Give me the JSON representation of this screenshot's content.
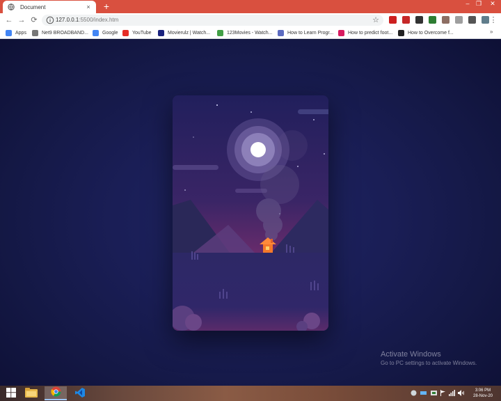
{
  "browser": {
    "tab_title": "Document",
    "tab_close": "×",
    "new_tab": "+",
    "window_controls": {
      "minimize": "–",
      "maximize": "❐",
      "close": "✕"
    },
    "nav": {
      "back": "←",
      "forward": "→",
      "reload": "⟳"
    },
    "url_host": "127.0.0.1",
    "url_path": ":5500/index.htm",
    "bookmark_star": "☆",
    "menu": "⋮",
    "extensions": [
      {
        "name": "opera-icon",
        "color": "#cc1f1f"
      },
      {
        "name": "red-box-icon",
        "color": "#c62828"
      },
      {
        "name": "store-icon",
        "color": "#333333"
      },
      {
        "name": "green-cube-icon",
        "color": "#2e7d32"
      },
      {
        "name": "grid-icon",
        "color": "#8d6e63"
      },
      {
        "name": "cloud-icon",
        "color": "#9e9e9e"
      },
      {
        "name": "puzzle-icon",
        "color": "#555555"
      },
      {
        "name": "profile-icon",
        "color": "#607d8b"
      }
    ]
  },
  "bookmarks": [
    {
      "label": "Apps",
      "icon": "apps-grid-icon",
      "color": "#4285f4"
    },
    {
      "label": "Net9 BROADBAND...",
      "icon": "globe-icon",
      "color": "#777777"
    },
    {
      "label": "Google",
      "icon": "google-icon",
      "color": "#4285f4"
    },
    {
      "label": "YouTube",
      "icon": "youtube-icon",
      "color": "#e52d27"
    },
    {
      "label": "Movierulz | Watch...",
      "icon": "movierulz-icon",
      "color": "#1a237e"
    },
    {
      "label": "123Movies - Watch...",
      "icon": "movies-icon",
      "color": "#43a047"
    },
    {
      "label": "How to Learn Progr...",
      "icon": "learn-icon",
      "color": "#5c6bc0"
    },
    {
      "label": "How to predict foot...",
      "icon": "k-icon",
      "color": "#d81b60"
    },
    {
      "label": "How to Overcome f...",
      "icon": "medium-icon",
      "color": "#222222"
    }
  ],
  "bookmarks_more": "»",
  "page": {
    "colors": {
      "sky_top": "#23215e",
      "sky_bottom": "#6e2c6c",
      "ground": "#2f2867",
      "moon": "#ffffff",
      "house": "#f4792a"
    }
  },
  "watermark": {
    "title": "Activate Windows",
    "subtitle": "Go to PC settings to activate Windows."
  },
  "taskbar": {
    "apps": [
      {
        "name": "start-button",
        "icon": "windows-icon"
      },
      {
        "name": "file-explorer-button",
        "icon": "folder-icon"
      },
      {
        "name": "chrome-button",
        "icon": "chrome-icon"
      },
      {
        "name": "vscode-button",
        "icon": "vscode-icon"
      }
    ],
    "clock_time": "3:06 PM",
    "clock_date": "28-Nov-20"
  }
}
